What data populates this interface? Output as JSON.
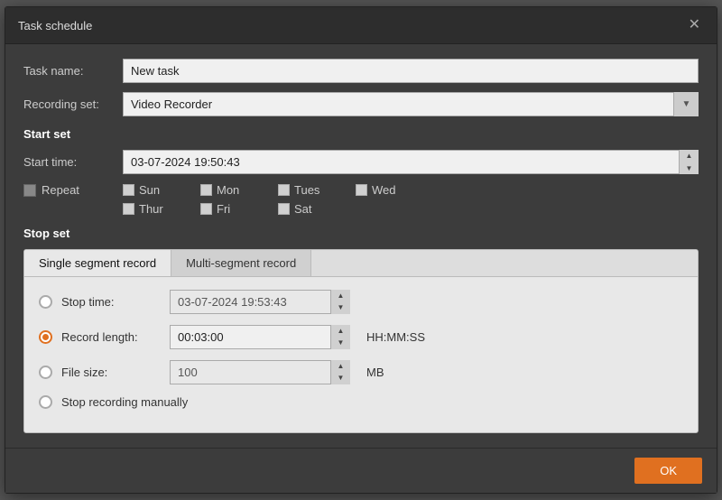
{
  "dialog": {
    "title": "Task schedule",
    "close_label": "✕"
  },
  "form": {
    "task_name_label": "Task name:",
    "task_name_value": "New task",
    "recording_set_label": "Recording set:",
    "recording_set_value": "Video Recorder",
    "recording_set_options": [
      "Video Recorder"
    ]
  },
  "start_set": {
    "header": "Start set",
    "start_time_label": "Start time:",
    "start_time_value": "03-07-2024 19:50:43",
    "repeat_label": "Repeat",
    "days": {
      "row1": [
        "Sun",
        "Mon",
        "Tues",
        "Wed"
      ],
      "row2": [
        "Thur",
        "Fri",
        "Sat"
      ]
    }
  },
  "stop_set": {
    "header": "Stop set",
    "tabs": [
      "Single segment record",
      "Multi-segment record"
    ],
    "active_tab": 0,
    "stop_time_label": "Stop time:",
    "stop_time_value": "03-07-2024 19:53:43",
    "record_length_label": "Record length:",
    "record_length_value": "00:03:00",
    "record_length_unit": "HH:MM:SS",
    "file_size_label": "File size:",
    "file_size_value": "100",
    "file_size_unit": "MB",
    "stop_manual_label": "Stop recording manually",
    "selected_option": "record_length"
  },
  "footer": {
    "ok_label": "OK"
  }
}
